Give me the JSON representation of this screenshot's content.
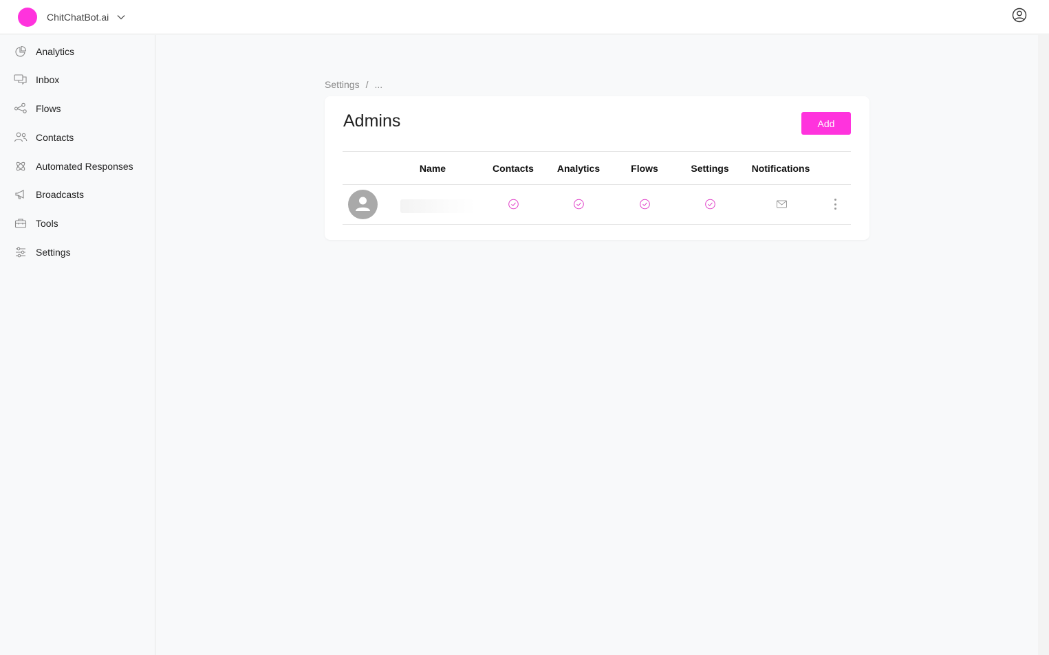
{
  "brand": {
    "name": "ChitChatBot.ai",
    "color": "#ff33dd"
  },
  "sidebar": {
    "items": [
      {
        "label": "Analytics",
        "icon": "pie-chart-icon"
      },
      {
        "label": "Inbox",
        "icon": "chat-bubbles-icon"
      },
      {
        "label": "Flows",
        "icon": "flow-nodes-icon"
      },
      {
        "label": "Contacts",
        "icon": "users-icon"
      },
      {
        "label": "Automated Responses",
        "icon": "atom-icon"
      },
      {
        "label": "Broadcasts",
        "icon": "megaphone-icon"
      },
      {
        "label": "Tools",
        "icon": "toolbox-icon"
      },
      {
        "label": "Settings",
        "icon": "sliders-icon"
      }
    ]
  },
  "breadcrumb": {
    "root": "Settings",
    "separator": "/",
    "current": "..."
  },
  "page": {
    "title": "Admins",
    "add_label": "Add"
  },
  "table": {
    "columns": [
      "Name",
      "Contacts",
      "Analytics",
      "Flows",
      "Settings",
      "Notifications"
    ],
    "rows": [
      {
        "name": "",
        "contacts": true,
        "analytics": true,
        "flows": true,
        "settings": true,
        "notifications": "email"
      }
    ]
  },
  "colors": {
    "accent": "#ff33dd",
    "check": "#e040c8"
  }
}
